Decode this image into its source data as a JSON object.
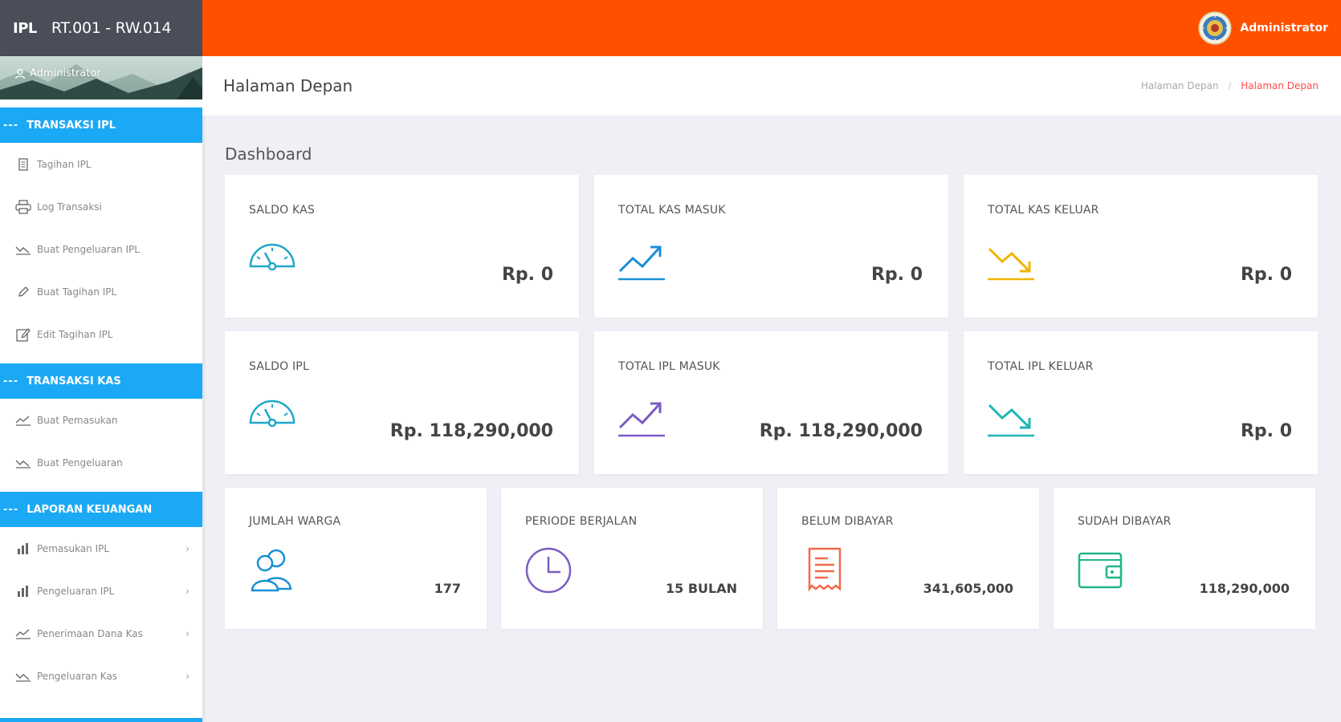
{
  "brand": {
    "logo": "IPL",
    "title": "RT.001 - RW.014"
  },
  "topbar": {
    "user_name": "Administrator",
    "user_avatar_icon": "emblem-avatar-icon"
  },
  "sidebar": {
    "profile_name": "Administrator",
    "sections": [
      {
        "title": "TRANSAKSI IPL",
        "items": [
          {
            "label": "Tagihan IPL",
            "icon": "file-icon"
          },
          {
            "label": "Log Transaksi",
            "icon": "printer-icon"
          },
          {
            "label": "Buat Pengeluaran IPL",
            "icon": "trend-down-icon"
          },
          {
            "label": "Buat Tagihan IPL",
            "icon": "pencil-icon"
          },
          {
            "label": "Edit Tagihan IPL",
            "icon": "edit-icon"
          }
        ]
      },
      {
        "title": "TRANSAKSI KAS",
        "items": [
          {
            "label": "Buat Pemasukan",
            "icon": "trend-up-icon"
          },
          {
            "label": "Buat Pengeluaran",
            "icon": "trend-down-icon"
          }
        ]
      },
      {
        "title": "LAPORAN KEUANGAN",
        "items": [
          {
            "label": "Pemasukan IPL",
            "icon": "bar-chart-icon"
          },
          {
            "label": "Pengeluaran IPL",
            "icon": "bar-chart-icon"
          },
          {
            "label": "Penerimaan Dana Kas",
            "icon": "trend-up-icon"
          },
          {
            "label": "Pengeluaran Kas",
            "icon": "trend-down-icon"
          }
        ]
      }
    ]
  },
  "header": {
    "page_title": "Halaman Depan",
    "breadcrumb": [
      "Halaman Depan",
      "Halaman Depan"
    ],
    "breadcrumb_sep": "/"
  },
  "dashboard": {
    "title": "Dashboard",
    "cards_row1": [
      {
        "label": "SALDO KAS",
        "value": "Rp. 0",
        "icon": "speedometer-icon",
        "color": "#1fa8c9"
      },
      {
        "label": "TOTAL KAS MASUK",
        "value": "Rp. 0",
        "icon": "trend-up-icon",
        "color": "#1a8fd8"
      },
      {
        "label": "TOTAL KAS KELUAR",
        "value": "Rp. 0",
        "icon": "trend-down-icon",
        "color": "#f0b400"
      }
    ],
    "cards_row2": [
      {
        "label": "SALDO IPL",
        "value": "Rp. 118,290,000",
        "icon": "speedometer-icon",
        "color": "#1fa8c9"
      },
      {
        "label": "TOTAL IPL MASUK",
        "value": "Rp. 118,290,000",
        "icon": "trend-up-icon",
        "color": "#7b5cc4"
      },
      {
        "label": "TOTAL IPL KELUAR",
        "value": "Rp. 0",
        "icon": "trend-down-icon",
        "color": "#1fb5b5"
      }
    ],
    "cards_row3": [
      {
        "label": "JUMLAH WARGA",
        "value": "177",
        "icon": "users-icon",
        "color": "#1a8fd8"
      },
      {
        "label": "PERIODE BERJALAN",
        "value": "15 BULAN",
        "icon": "clock-icon",
        "color": "#7b5cc4"
      },
      {
        "label": "BELUM DIBAYAR",
        "value": "341,605,000",
        "icon": "receipt-icon",
        "color": "#f06a4a"
      },
      {
        "label": "SUDAH DIBAYAR",
        "value": "118,290,000",
        "icon": "wallet-icon",
        "color": "#1fb58a"
      }
    ]
  },
  "colors": {
    "topbar_accent": "#ff5000",
    "brand_bg": "#4a4e59",
    "section_header": "#1ba9f5",
    "breadcrumb_active": "#ff4b4b"
  }
}
